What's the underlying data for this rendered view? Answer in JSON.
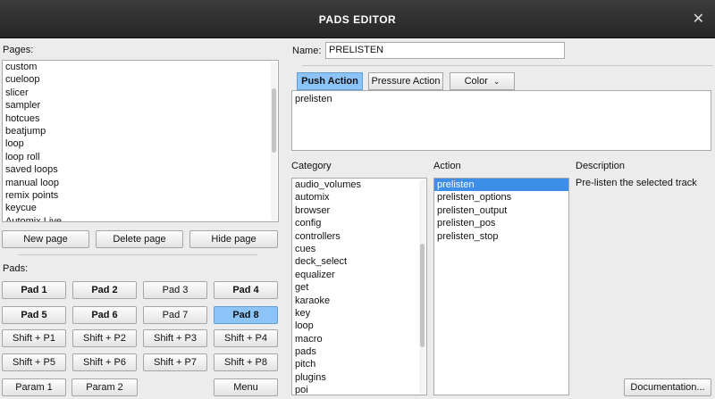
{
  "window": {
    "title": "PADS EDITOR",
    "close_glyph": "✕"
  },
  "pages": {
    "label": "Pages:",
    "items": [
      "custom",
      "cueloop",
      "slicer",
      "sampler",
      "hotcues",
      "beatjump",
      "loop",
      "loop roll",
      "saved loops",
      "manual loop",
      "remix points",
      "keycue",
      "Automix Live"
    ],
    "buttons": {
      "new": "New page",
      "delete": "Delete page",
      "hide": "Hide page"
    }
  },
  "pads": {
    "label": "Pads:",
    "rows": [
      [
        "Pad 1",
        "Pad 2",
        "Pad 3",
        "Pad 4"
      ],
      [
        "Pad 5",
        "Pad 6",
        "Pad 7",
        "Pad 8"
      ],
      [
        "Shift + P1",
        "Shift + P2",
        "Shift + P3",
        "Shift + P4"
      ],
      [
        "Shift + P5",
        "Shift + P6",
        "Shift + P7",
        "Shift + P8"
      ]
    ],
    "bold_pads": [
      "Pad 1",
      "Pad 2",
      "Pad 4",
      "Pad 5",
      "Pad 6",
      "Pad 8"
    ],
    "selected_pad": "Pad 8",
    "param1": "Param 1",
    "param2": "Param 2",
    "menu": "Menu"
  },
  "name": {
    "label": "Name:",
    "value": "PRELISTEN"
  },
  "tabs": {
    "push": "Push Action",
    "pressure": "Pressure Action",
    "color": "Color",
    "chevron": "⌄",
    "active": "push"
  },
  "script_text": "prelisten",
  "category": {
    "label": "Category",
    "items": [
      "audio_volumes",
      "automix",
      "browser",
      "config",
      "controllers",
      "cues",
      "deck_select",
      "equalizer",
      "get",
      "karaoke",
      "key",
      "loop",
      "macro",
      "pads",
      "pitch",
      "plugins",
      "poi"
    ]
  },
  "action": {
    "label": "Action",
    "items": [
      "prelisten",
      "prelisten_options",
      "prelisten_output",
      "prelisten_pos",
      "prelisten_stop"
    ],
    "selected": "prelisten"
  },
  "description": {
    "label": "Description",
    "text": "Pre-listen the selected track"
  },
  "documentation_button": "Documentation...",
  "colors": {
    "accent": "#8dc4f7",
    "selection": "#3d8ee8",
    "titlebar": "#2e2e2e"
  }
}
